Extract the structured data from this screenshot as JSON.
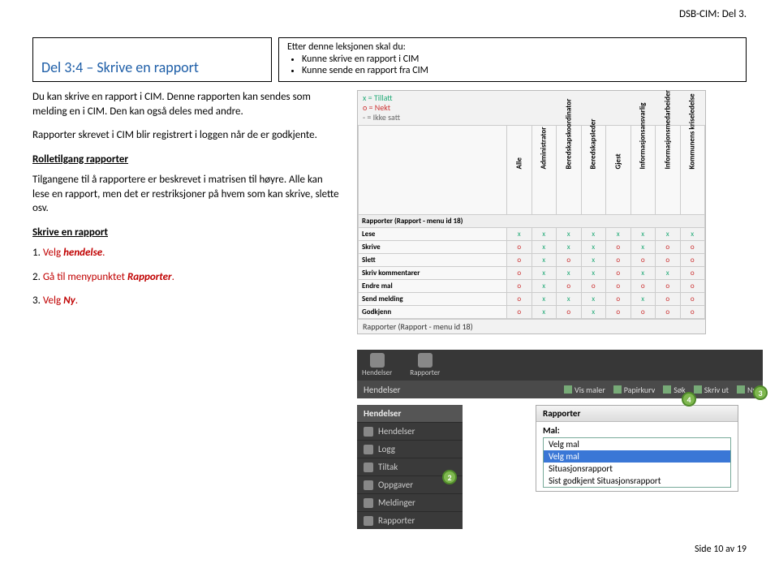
{
  "header": {
    "doc_ref": "DSB-CIM: Del 3."
  },
  "title_box": {
    "text": "Del 3:4 – Skrive en rapport"
  },
  "lesson_box": {
    "heading": "Etter denne leksjonen skal du:",
    "items": [
      "Kunne skrive en rapport i CIM",
      "Kunne sende en rapport fra CIM"
    ]
  },
  "left": {
    "p1": "Du kan skrive en rapport i CIM. Denne rapporten kan sendes som melding en i CIM. Den kan også deles med andre.",
    "p2": "Rapporter skrevet i CIM blir registrert i loggen når de er godkjente.",
    "h1": "Rolletilgang rapporter",
    "p3": "Tilgangene til å rapportere er beskrevet i matrisen til høyre. Alle kan lese en rapport, men det er restriksjoner på hvem som kan skrive, slette osv.",
    "h2": "Skrive en rapport",
    "steps": [
      {
        "num": "1.",
        "verb": "Velg ",
        "obj": "hendelse",
        "tail": "."
      },
      {
        "num": "2.",
        "verb": "Gå til menypunktet ",
        "obj": "Rapporter",
        "tail": "."
      },
      {
        "num": "3.",
        "verb": "Velg ",
        "obj": "Ny",
        "tail": "."
      }
    ]
  },
  "matrix": {
    "legend": {
      "x": "x = Tillatt",
      "o": "o = Nekt",
      "dash": "- = Ikke satt"
    },
    "caption": "Rapporter (Rapport - menu id 18)",
    "cols": [
      "Alle",
      "Administrator",
      "Beredskapskoordinator",
      "Beredskapsleder",
      "Gjest",
      "Informasjonsansvarlig",
      "Informasjonsmedarbeider",
      "Kommunens kriseledelse"
    ],
    "rows": [
      {
        "name": "Lese",
        "cells": [
          "x",
          "x",
          "x",
          "x",
          "x",
          "x",
          "x",
          "x"
        ]
      },
      {
        "name": "Skrive",
        "cells": [
          "o",
          "x",
          "x",
          "x",
          "o",
          "x",
          "o",
          "o"
        ]
      },
      {
        "name": "Slett",
        "cells": [
          "o",
          "x",
          "o",
          "x",
          "o",
          "o",
          "o",
          "o"
        ]
      },
      {
        "name": "Skriv kommentarer",
        "cells": [
          "o",
          "x",
          "x",
          "x",
          "o",
          "x",
          "x",
          "o"
        ]
      },
      {
        "name": "Endre mal",
        "cells": [
          "o",
          "x",
          "o",
          "o",
          "o",
          "o",
          "o",
          "o"
        ]
      },
      {
        "name": "Send melding",
        "cells": [
          "o",
          "x",
          "x",
          "x",
          "o",
          "x",
          "o",
          "o"
        ]
      },
      {
        "name": "Godkjenn",
        "cells": [
          "o",
          "x",
          "o",
          "x",
          "o",
          "o",
          "o",
          "o"
        ]
      }
    ]
  },
  "ui": {
    "top_tabs": [
      "Hendelser",
      "Rapporter"
    ],
    "bar2_left": "Hendelser",
    "bar2_right": [
      "Vis maler",
      "Papirkurv",
      "Søk",
      "Skriv ut",
      "Ny"
    ],
    "left_menu_title": "Hendelser",
    "left_menu_items": [
      "Hendelser",
      "Logg",
      "Tiltak",
      "Oppgaver",
      "Meldinger",
      "Rapporter"
    ],
    "right_panel_title": "Rapporter",
    "mal_label": "Mal:",
    "mal_options": [
      "Velg mal",
      "Velg mal",
      "Situasjonsrapport",
      "Sist godkjent Situasjonsrapport"
    ],
    "badges": {
      "b2": "2",
      "b3": "3",
      "b4": "4"
    }
  },
  "footer": {
    "page": "Side 10 av 19"
  }
}
